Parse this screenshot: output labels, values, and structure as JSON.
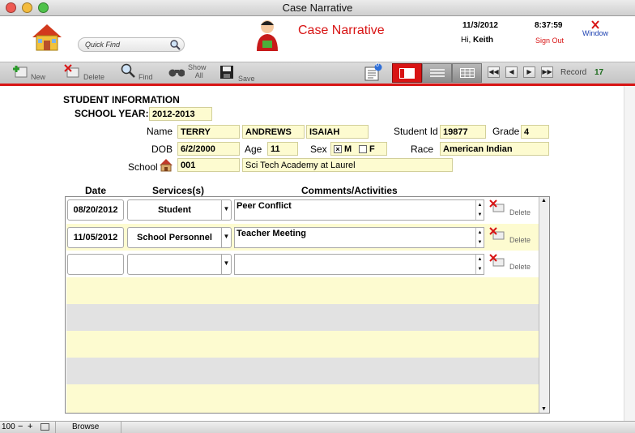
{
  "window": {
    "title": "Case Narrative"
  },
  "header": {
    "quick_find_placeholder": "Quick Find",
    "app_title": "Case Narrative",
    "date": "11/3/2012",
    "time": "8:37:59",
    "greeting": "Hi,",
    "user": "Keith",
    "sign_out": "Sign Out",
    "window_label": "Window"
  },
  "toolbar": {
    "new": "New",
    "delete": "Delete",
    "find": "Find",
    "show_all_1": "Show",
    "show_all_2": "All",
    "save": "Save",
    "badge": "0",
    "record_label": "Record",
    "record_number": "17"
  },
  "form": {
    "section_title": "STUDENT INFORMATION",
    "school_year_label": "SCHOOL YEAR:",
    "school_year": "2012-2013",
    "name_label": "Name",
    "first_name": "TERRY",
    "last_name": "ANDREWS",
    "middle_name": "ISAIAH",
    "student_id_label": "Student Id",
    "student_id": "19877",
    "grade_label": "Grade",
    "grade": "4",
    "dob_label": "DOB",
    "dob": "6/2/2000",
    "age_label": "Age",
    "age": "11",
    "sex_label": "Sex",
    "sex_m": "M",
    "sex_f": "F",
    "race_label": "Race",
    "race": "American Indian",
    "school_label": "School",
    "school_code": "001",
    "school_name": "Sci Tech Academy at Laurel"
  },
  "portal": {
    "headers": {
      "date": "Date",
      "services": "Services(s)",
      "comments": "Comments/Activities"
    },
    "rows": [
      {
        "date": "08/20/2012",
        "service": "Student",
        "comment": "Peer Conflict",
        "delete": "Delete"
      },
      {
        "date": "11/05/2012",
        "service": "School Personnel",
        "comment": "Teacher Meeting",
        "delete": "Delete"
      },
      {
        "date": "",
        "service": "",
        "comment": "",
        "delete": "Delete"
      }
    ]
  },
  "status": {
    "zoom": "100",
    "mode": "Browse"
  },
  "colors": {
    "accent_red": "#d81414",
    "field_yellow": "#fdfbd0",
    "row_gray": "#e2e2e2"
  }
}
